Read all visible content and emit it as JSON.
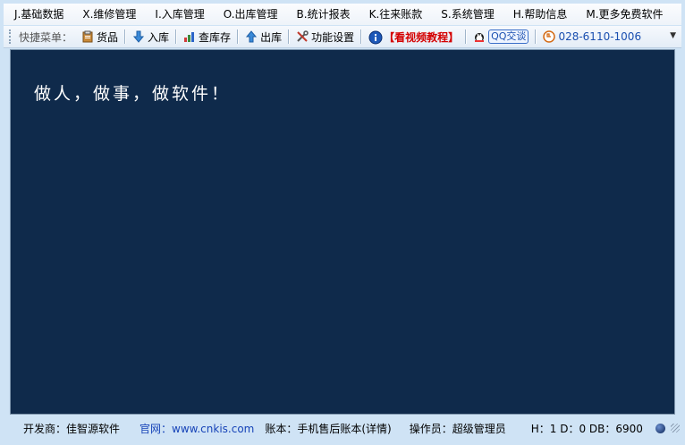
{
  "menu": [
    "J.基础数据",
    "X.维修管理",
    "I.入库管理",
    "O.出库管理",
    "B.统计报表",
    "K.往来账款",
    "S.系统管理",
    "H.帮助信息",
    "M.更多免费软件"
  ],
  "toolbar": {
    "label": "快捷菜单：",
    "goods": "货品",
    "stock_in": "入库",
    "check_stock": "查库存",
    "stock_out": "出库",
    "settings": "功能设置",
    "video": "【看视频教程】",
    "qq": "QQ交谈",
    "phone": "028-6110-1006"
  },
  "main": {
    "slogan": "做人，做事，做软件！"
  },
  "status": {
    "developer": "开发商：佳智源软件",
    "website": "官网：www.cnkis.com",
    "account": "账本：手机售后账本(详情)",
    "operator": "操作员：超级管理员",
    "db_info": "H：1 D：0 DB：6900"
  },
  "colors": {
    "main_bg": "#0f2a4b",
    "frame_bg": "#cfe3f5",
    "link_blue": "#1744b8",
    "video_red": "#d40000"
  }
}
